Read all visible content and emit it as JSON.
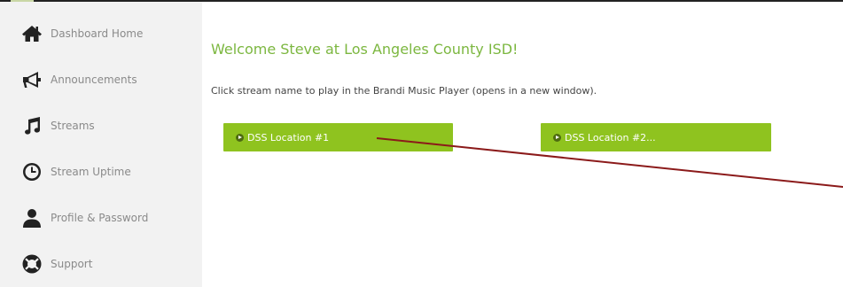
{
  "sidebar": {
    "items": [
      {
        "label": "Dashboard Home",
        "icon": "home-icon"
      },
      {
        "label": "Announcements",
        "icon": "megaphone-icon"
      },
      {
        "label": "Streams",
        "icon": "music-note-icon"
      },
      {
        "label": "Stream Uptime",
        "icon": "clock-icon"
      },
      {
        "label": "Profile & Password",
        "icon": "user-icon"
      },
      {
        "label": "Support",
        "icon": "lifebuoy-icon"
      }
    ]
  },
  "main": {
    "welcome": "Welcome Steve at Los Angeles County ISD!",
    "instruction": "Click stream name to play in the Brandi Music Player (opens in a new window).",
    "streams": [
      {
        "label": "DSS Location #1",
        "icon": "play-circle-icon"
      },
      {
        "label": "DSS Location #2...",
        "icon": "play-circle-icon"
      }
    ]
  },
  "colors": {
    "accent_green": "#8fc31f",
    "title_green": "#7cb740",
    "sidebar_bg": "#f2f2f2",
    "annotation_line": "#8b1a1a"
  }
}
